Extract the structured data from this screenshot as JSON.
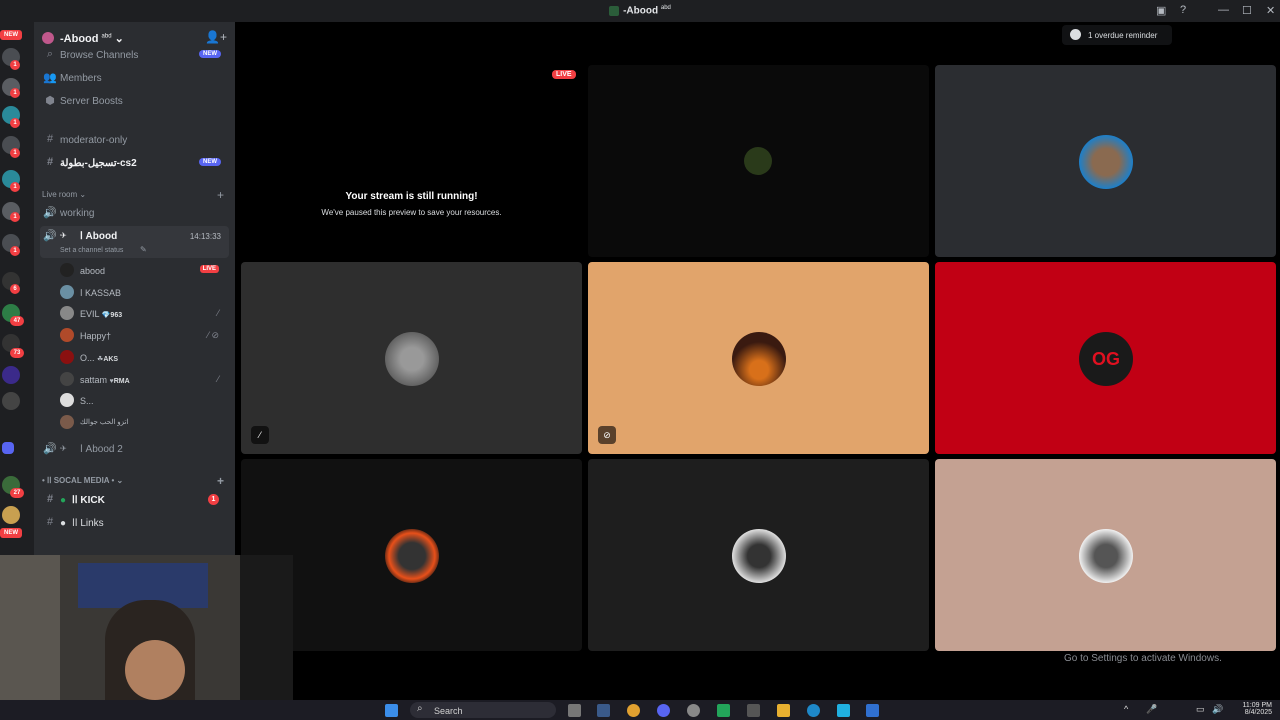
{
  "window": {
    "title": "-Abood",
    "title_sup": "abd"
  },
  "server": {
    "name": "-Abood",
    "name_sup": "abd"
  },
  "guild_badges": [
    "NEW",
    "1",
    "1",
    "1",
    "1",
    "1",
    "1",
    "1",
    "1",
    "6",
    "47",
    "73",
    "27",
    "NEW"
  ],
  "sidebar": {
    "browse_label": "Browse Channels",
    "browse_pill": "NEW",
    "members_label": "Members",
    "boosts_label": "Server Boosts",
    "ch_moderator": "moderator-only",
    "ch_tasjeel": "تسجيل-بطولة-cs2",
    "ch_tasjeel_pill": "NEW",
    "cat_live": "Live room",
    "ch_working": "working",
    "ch_abood": "ا Abood",
    "ch_abood_time": "14:13:33",
    "ch_abood_status": "Set a channel status",
    "voice_users": [
      {
        "name": "abood",
        "badge": "LIVE"
      },
      {
        "name": "ا KASSAB",
        "badge": ""
      },
      {
        "name": "EVIL",
        "tag": "963"
      },
      {
        "name": "Happy†",
        "tag": ""
      },
      {
        "name": "O...",
        "tag": "AKS"
      },
      {
        "name": "sattam",
        "tag": "RMA"
      },
      {
        "name": "S...",
        "tag": ""
      },
      {
        "name": "اتزو الحب جوالك",
        "tag": ""
      }
    ],
    "ch_abood2": "ا Abood 2",
    "cat_social": "• اا SOCAL MEDIA •",
    "ch_kick": "اا KICK",
    "ch_kick_badge": "1",
    "ch_links": "اا Links"
  },
  "stage": {
    "live_badge": "LIVE",
    "stream_title": "Your stream is still running!",
    "stream_sub": "We've paused this preview to save your resources.",
    "reminder": "1 overdue reminder",
    "watermark": "Go to Settings to activate Windows.",
    "tile_colors": [
      "#000000",
      "#0a0a0a",
      "#2b2d31",
      "#2e2e2e",
      "#e1a46b",
      "#c10014",
      "#111111",
      "#1e1e1e",
      "#c4a192"
    ]
  },
  "taskbar": {
    "search": "Search",
    "time": "11:09 PM",
    "date": "8/4/2025"
  }
}
